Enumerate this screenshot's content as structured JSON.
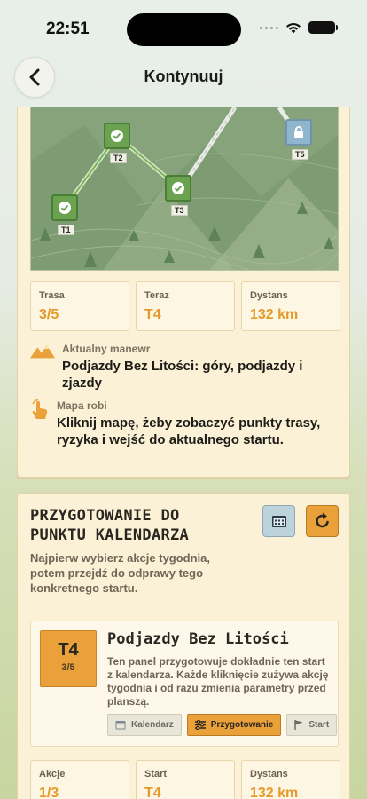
{
  "status_bar": {
    "time": "22:51"
  },
  "header": {
    "title": "Kontynuuj",
    "back_icon": "chevron-left-icon"
  },
  "map": {
    "nodes": [
      {
        "label": "T1",
        "state": "done"
      },
      {
        "label": "T2",
        "state": "done"
      },
      {
        "label": "T3",
        "state": "done"
      },
      {
        "label": "T5",
        "state": "locked"
      }
    ],
    "colors": {
      "done": "#6aa24f",
      "locked": "#8fb6cc",
      "terrain": "#7fa077"
    }
  },
  "route_stats": [
    {
      "label": "Trasa",
      "value": "3/5"
    },
    {
      "label": "Teraz",
      "value": "T4"
    },
    {
      "label": "Dystans",
      "value": "132 km"
    }
  ],
  "maneuver": {
    "label": "Aktualny manewr",
    "text": "Podjazdy Bez Litości: góry, podjazdy i zjazdy",
    "icon": "mountains-icon"
  },
  "map_hint": {
    "label": "Mapa robi",
    "text": "Kliknij mapę, żeby zobaczyć punkty trasy, ryzyka i wejść do aktualnego startu.",
    "icon": "tap-hand-icon"
  },
  "prep": {
    "title": "PRZYGOTOWANIE DO PUNKTU KALENDARZA",
    "description": "Najpierw wybierz akcje tygodnia, potem przejdź do odprawy tego konkretnego startu.",
    "calendar_button_icon": "calendar-icon",
    "refresh_button_icon": "refresh-icon",
    "stage": {
      "badge_code": "T4",
      "badge_progress": "3/5",
      "name": "Podjazdy Bez Litości",
      "description": "Ten panel przygotowuje dokładnie ten start z kalendarza. Każde kliknięcie zużywa akcję tygodnia i od razu zmienia parametry przed planszą.",
      "chips": {
        "calendar": "Kalendarz",
        "preparation": "Przygotowanie",
        "start": "Start"
      }
    },
    "stats": [
      {
        "label": "Akcje",
        "value": "1/3"
      },
      {
        "label": "Start",
        "value": "T4"
      },
      {
        "label": "Dystans",
        "value": "132 km"
      }
    ]
  },
  "accent_color": "#e49a2c"
}
